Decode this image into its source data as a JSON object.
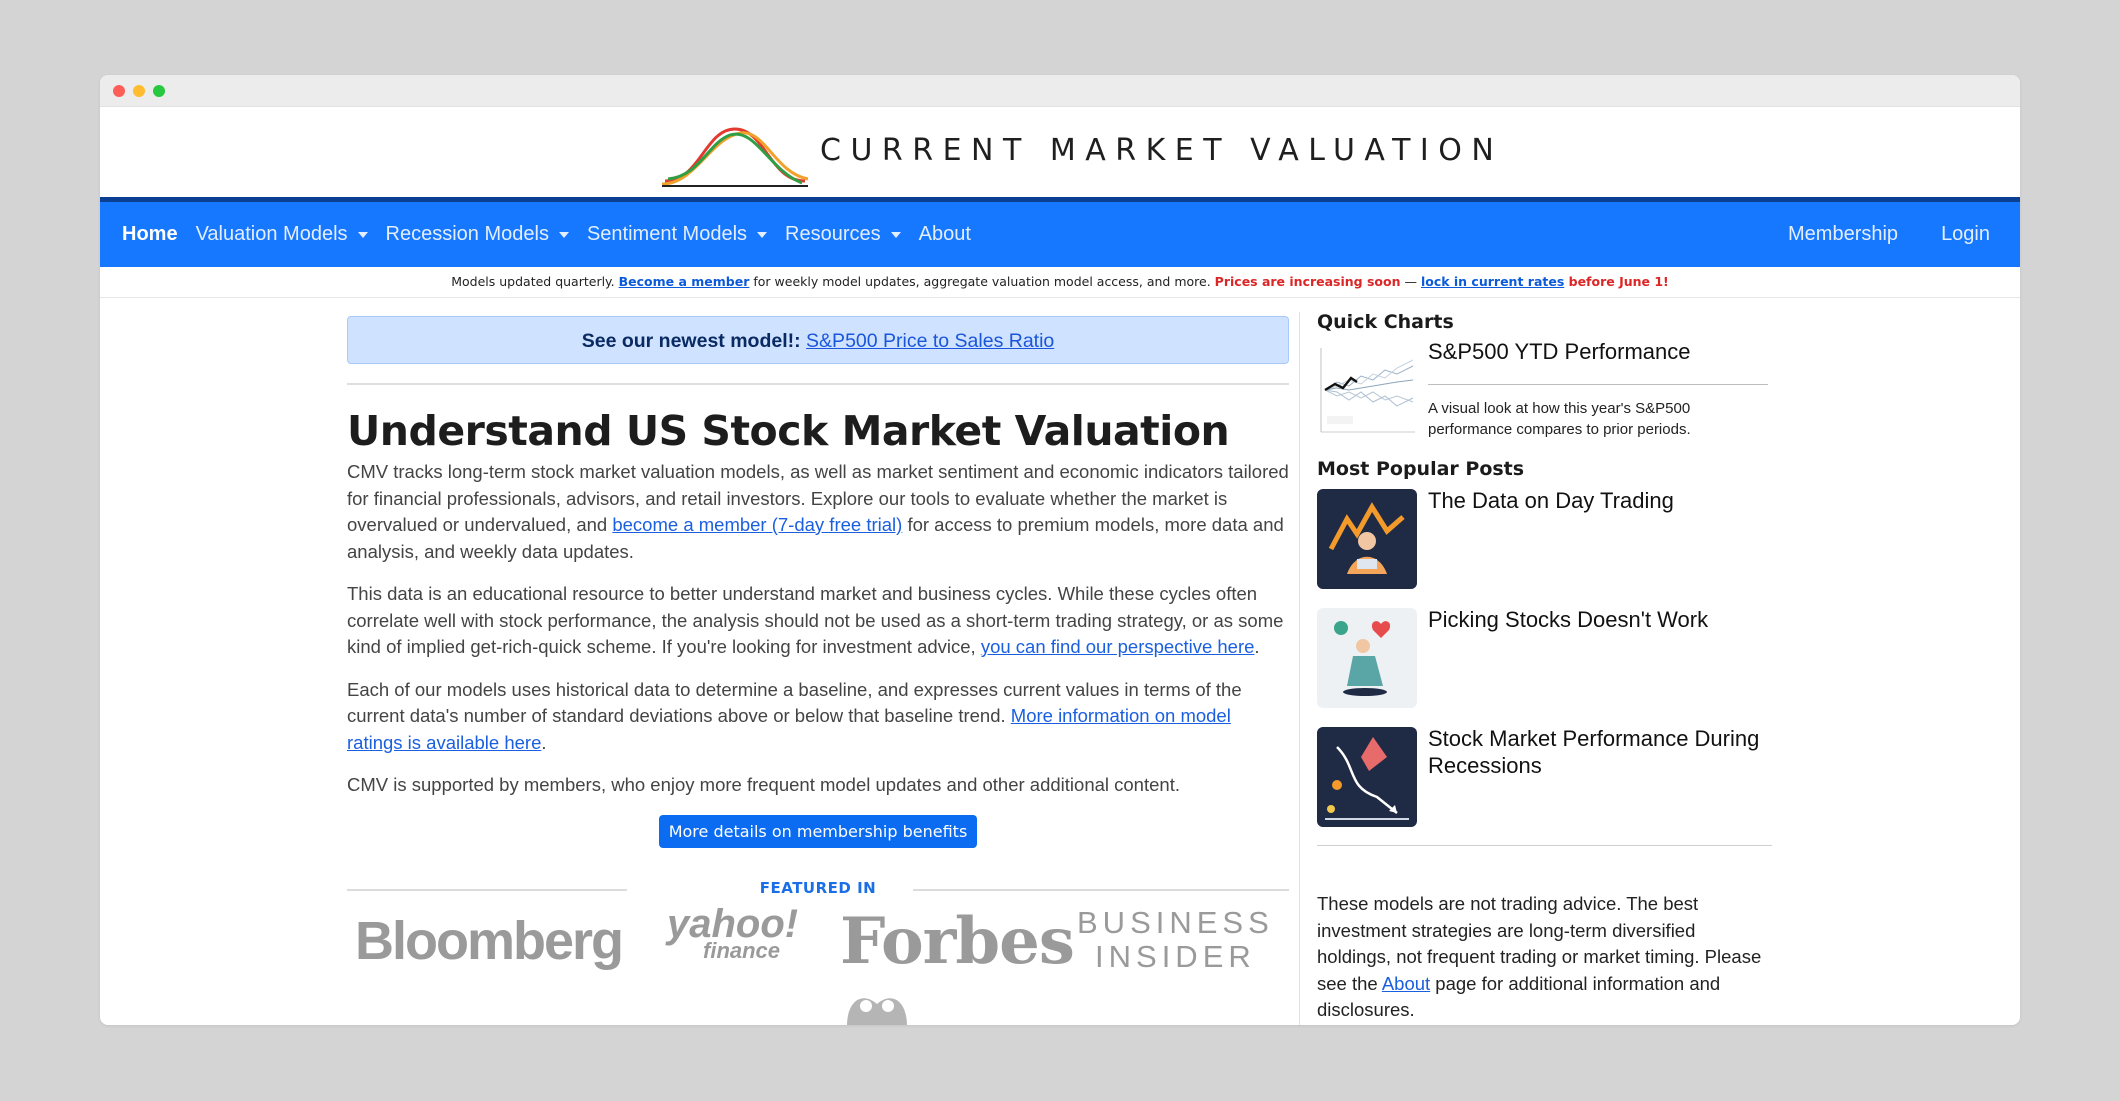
{
  "site": {
    "logo_text": "CURRENT MARKET VALUATION"
  },
  "nav": {
    "left": [
      {
        "label": "Home",
        "dropdown": false,
        "active": true
      },
      {
        "label": "Valuation Models",
        "dropdown": true
      },
      {
        "label": "Recession Models",
        "dropdown": true
      },
      {
        "label": "Sentiment Models",
        "dropdown": true
      },
      {
        "label": "Resources",
        "dropdown": true
      },
      {
        "label": "About",
        "dropdown": false
      }
    ],
    "right": [
      {
        "label": "Membership"
      },
      {
        "label": "Login"
      }
    ]
  },
  "notice": {
    "prefix": "Models updated quarterly. ",
    "member_link": "Become a member",
    "middle": " for weekly model updates, aggregate valuation model access, and more. ",
    "warning": "Prices are increasing soon",
    "dash": " — ",
    "rates_link": "lock in current rates",
    "deadline": " before June 1!"
  },
  "banner": {
    "label": "See our newest model!:",
    "link": "S&P500 Price to Sales Ratio"
  },
  "main": {
    "title": "Understand US Stock Market Valuation",
    "p1_a": "CMV tracks long-term stock market valuation models, as well as market sentiment and economic indicators tailored for financial professionals, advisors, and retail investors. Explore our tools to evaluate whether the market is overvalued or undervalued, and ",
    "p1_link": "become a member (7-day free trial)",
    "p1_b": " for access to premium models, more data and analysis, and weekly data updates.",
    "p2_a": "This data is an educational resource to better understand market and business cycles. While these cycles often correlate well with stock performance, the analysis should not be used as a short-term trading strategy, or as some kind of implied get-rich-quick scheme. If you're looking for investment advice, ",
    "p2_link": "you can find our perspective here",
    "p2_b": ".",
    "p3_a": "Each of our models uses historical data to determine a baseline, and expresses current values in terms of the current data's number of standard deviations above or below that baseline trend. ",
    "p3_link": "More information on model ratings is available here",
    "p3_b": ".",
    "p4": "CMV is supported by members, who enjoy more frequent model updates and other additional content.",
    "button": "More details on membership benefits",
    "featured_label": "FEATURED IN",
    "logos": {
      "bloomberg": "Bloomberg",
      "yahoo": "yahoo!",
      "yahoo_sub": "finance",
      "forbes": "Forbes",
      "bi_line1": "BUSINESS",
      "bi_line2": "INSIDER"
    }
  },
  "sidebar": {
    "quick_charts_title": "Quick Charts",
    "quick_chart": {
      "title": "S&P500 YTD Performance",
      "desc": "A visual look at how this year's S&P500 performance compares to prior periods."
    },
    "popular_title": "Most Popular Posts",
    "posts": [
      {
        "title": "The Data on Day Trading"
      },
      {
        "title": "Picking Stocks Doesn't Work"
      },
      {
        "title": "Stock Market Performance During Recessions"
      }
    ],
    "disclaimer_a": "These models are not trading advice. The best investment strategies are long-term diversified holdings, not frequent trading or market timing. Please see the ",
    "disclaimer_link": "About",
    "disclaimer_b": " page for additional information and disclosures."
  },
  "colors": {
    "nav_bg": "#1677ff",
    "nav_border": "#0b3f91",
    "banner_bg": "#cfe2ff",
    "button_bg": "#0b6cf2",
    "warning": "#dc2626",
    "link": "#1a5fe0"
  }
}
